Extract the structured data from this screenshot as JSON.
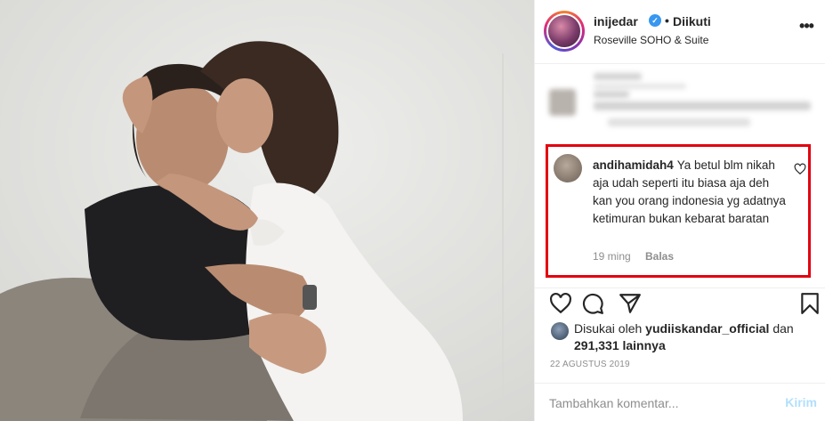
{
  "header": {
    "username": "inijedar",
    "verified_symbol": "✓",
    "separator": "•",
    "follow_status": "Diikuti",
    "location": "Roseville SOHO & Suite",
    "more_symbol": "•••"
  },
  "highlighted_comment": {
    "username": "andihamidah4",
    "text": "Ya betul blm nikah aja udah seperti itu biasa aja deh kan you orang indonesia yg adatnya ketimuran bukan kebarat baratan",
    "time": "19 ming",
    "reply_label": "Balas"
  },
  "likes": {
    "prefix": "Disukai oleh",
    "user": "yudiiskandar_official",
    "connector": "dan",
    "count": "291,331 lainnya"
  },
  "post_date": "22 AGUSTUS 2019",
  "comment_box": {
    "placeholder": "Tambahkan komentar...",
    "post_label": "Kirim"
  },
  "colors": {
    "highlight_border": "#e3000f",
    "verified_blue": "#3897f0",
    "muted_text": "#8e8e8e"
  }
}
